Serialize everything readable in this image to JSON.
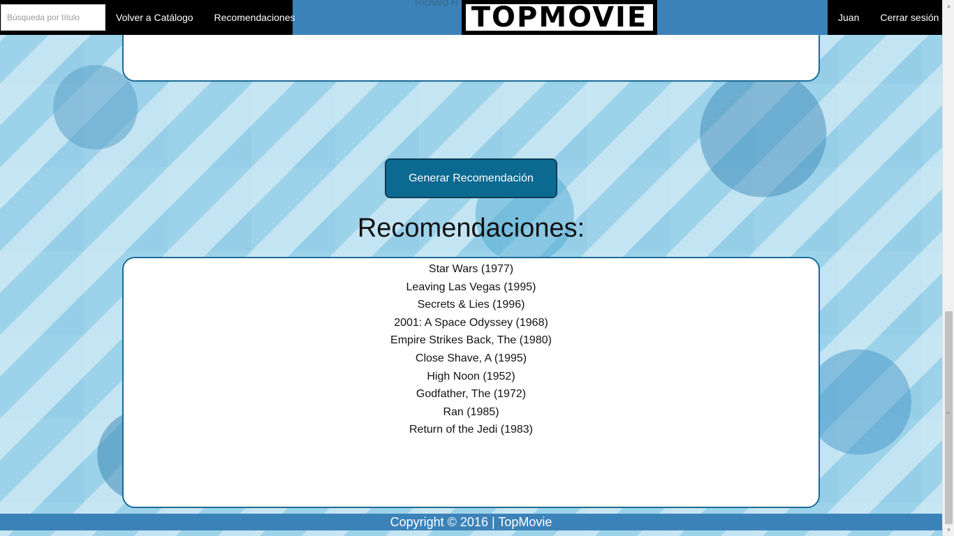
{
  "nav": {
    "search_placeholder": "Búsqueda por título",
    "links": [
      "Volver a Catálogo",
      "Recomendaciones"
    ],
    "logo": "TOPMOVIE",
    "user": "Juan",
    "logout": "Cerrar sesión",
    "truncated_text": "Richard H"
  },
  "main": {
    "generate_button": "Generar Recomendación",
    "recommendations_title": "Recomendaciones:",
    "recommendations": [
      "Star Wars (1977)",
      "Leaving Las Vegas (1995)",
      "Secrets & Lies (1996)",
      "2001: A Space Odyssey (1968)",
      "Empire Strikes Back, The (1980)",
      "Close Shave, A (1995)",
      "High Noon (1952)",
      "Godfather, The (1972)",
      "Ran (1985)",
      "Return of the Jedi (1983)"
    ]
  },
  "footer": {
    "text": "Copyright © 2016 | TopMovie"
  },
  "colors": {
    "nav_blue": "#3b82b8",
    "button_blue": "#0c6a90",
    "panel_border": "#1a6b95"
  },
  "icons": {
    "scroll_up": "triangle-up-icon",
    "scroll_down": "triangle-down-icon"
  }
}
